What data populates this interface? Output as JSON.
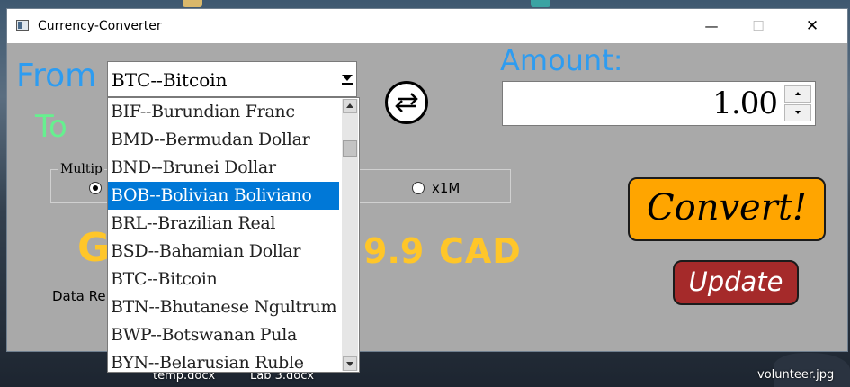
{
  "window": {
    "title": "Currency-Converter"
  },
  "labels": {
    "from": "From",
    "to": "To",
    "amount": "Amount:",
    "multiplier_group": "Multip",
    "data_refresh": "Data Re"
  },
  "from_combo": {
    "selected": "BTC--Bitcoin"
  },
  "dropdown": {
    "items": [
      "BIF--Burundian Franc",
      "BMD--Bermudan Dollar",
      "BND--Brunei Dollar",
      "BOB--Bolivian Boliviano",
      "BRL--Brazilian Real",
      "BSD--Bahamian Dollar",
      "BTC--Bitcoin",
      "BTN--Bhutanese Ngultrum",
      "BWP--Botswanan Pula",
      "BYN--Belarusian Ruble"
    ],
    "highlighted_index": 3
  },
  "amount": {
    "value": "1.00"
  },
  "multiplier": {
    "option_1m_label": "x1M",
    "selected": "first"
  },
  "result": {
    "left_glyph": "G",
    "value_visible": "9.9",
    "currency": "CAD"
  },
  "buttons": {
    "convert": "Convert!",
    "update": "Update"
  },
  "desktop": {
    "file_1": "temp.docx",
    "file_2": "Lab 3.docx",
    "file_3": "volunteer.jpg"
  },
  "colors": {
    "window_bg": "#a9a9a9",
    "from_label": "#2e9cf0",
    "to_label": "#66f08f",
    "amount_label": "#2e9cf0",
    "result": "#ffc629",
    "convert_bg": "#ffa500",
    "update_bg": "#a52a2a",
    "selection": "#0078d7"
  },
  "icons": {
    "app": "app-window-icon",
    "swap": "swap-arrows-icon"
  }
}
